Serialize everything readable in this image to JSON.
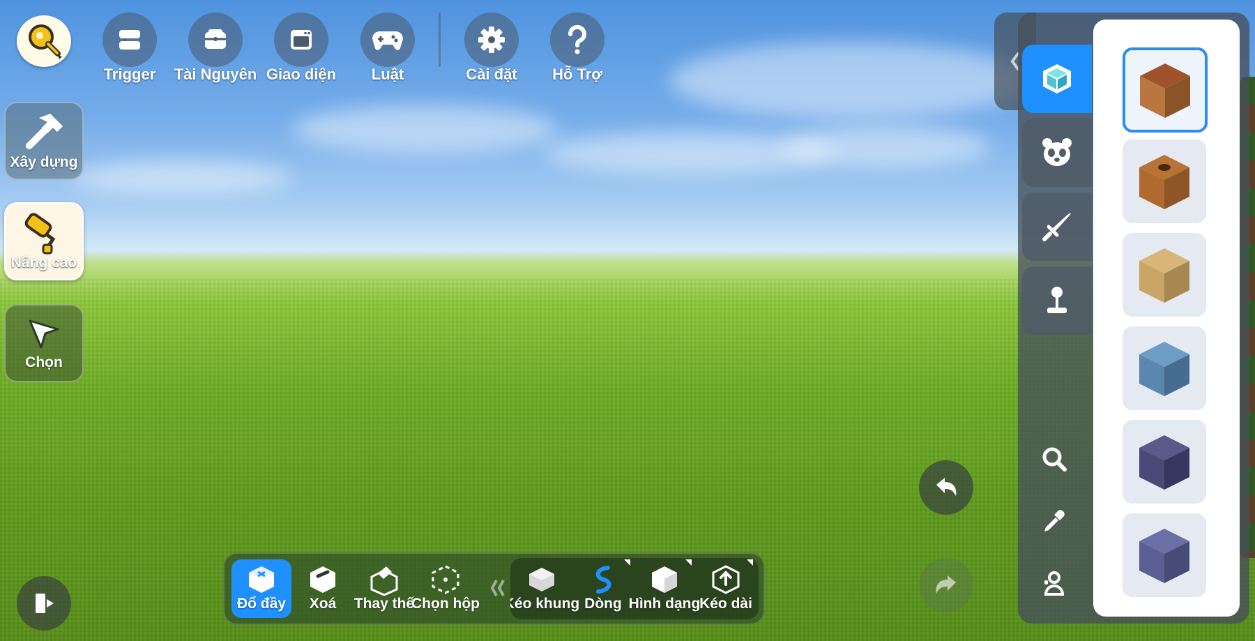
{
  "top_bar": {
    "items": [
      {
        "id": "trigger",
        "label": "Trigger",
        "icon": "trigger-icon"
      },
      {
        "id": "resource",
        "label": "Tài Nguyên",
        "icon": "wallet-icon"
      },
      {
        "id": "interface",
        "label": "Giao diện",
        "icon": "window-icon"
      },
      {
        "id": "rules",
        "label": "Luật",
        "icon": "gamepad-icon"
      },
      {
        "id": "settings",
        "label": "Cài đặt",
        "icon": "gear-icon"
      },
      {
        "id": "help",
        "label": "Hỗ Trợ",
        "icon": "question-icon"
      }
    ],
    "logo_icon": "wrench-bulb-icon"
  },
  "modes": {
    "build": {
      "label": "Xây dựng",
      "icon": "hammer-icon"
    },
    "advanced": {
      "label": "Nâng cao",
      "icon": "paint-roller-icon",
      "active": true
    },
    "select": {
      "label": "Chọn",
      "icon": "cursor-arrow-icon"
    }
  },
  "toolbar": {
    "tools": [
      {
        "label": "Đổ đầy",
        "icon": "fill-block-icon",
        "active": true
      },
      {
        "label": "Xoá",
        "icon": "erase-block-icon"
      },
      {
        "label": "Thay thế",
        "icon": "replace-block-icon"
      },
      {
        "label": "Chọn hộp",
        "icon": "box-select-icon"
      }
    ],
    "group2": [
      {
        "label": "Kéo khung",
        "icon": "frame-drag-icon",
        "has_options": false
      },
      {
        "label": "Dòng",
        "icon": "line-curve-icon",
        "has_options": true
      },
      {
        "label": "Hình dạng",
        "icon": "shape-cube-icon",
        "has_options": true
      },
      {
        "label": "Kéo dài",
        "icon": "extend-icon",
        "has_options": true
      }
    ]
  },
  "actions": {
    "undo_icon": "undo-icon",
    "redo_icon": "redo-icon",
    "exit_icon": "exit-door-icon"
  },
  "right_panel": {
    "collapse_icon": "chevron-left-icon",
    "categories": [
      {
        "id": "blocks",
        "icon": "cube-icon",
        "active": true
      },
      {
        "id": "creatures",
        "icon": "panda-icon"
      },
      {
        "id": "items",
        "icon": "sword-icon"
      },
      {
        "id": "devices",
        "icon": "joystick-icon"
      }
    ],
    "tools": [
      {
        "id": "search",
        "icon": "search-icon"
      },
      {
        "id": "picker",
        "icon": "eyedropper-icon"
      },
      {
        "id": "character",
        "icon": "character-icon"
      }
    ],
    "blocks": [
      {
        "name": "dirt-grass-block",
        "top": "#a0522d",
        "side": "#b9773f",
        "dark": "#8a5428",
        "selected": true
      },
      {
        "name": "hollow-dirt-block",
        "top": "#b87335",
        "side": "#b06a30",
        "dark": "#8e5626"
      },
      {
        "name": "sand-block",
        "top": "#d8b679",
        "side": "#c9a566",
        "dark": "#a98750"
      },
      {
        "name": "blue-stone-block",
        "top": "#6f9cc4",
        "side": "#5b86ae",
        "dark": "#466c92"
      },
      {
        "name": "dark-purple-stone-block",
        "top": "#5a5a8a",
        "side": "#4a4a78",
        "dark": "#363660"
      },
      {
        "name": "slate-blue-block",
        "top": "#6a6fa4",
        "side": "#5b5f93",
        "dark": "#474b78"
      }
    ]
  },
  "colors": {
    "accent": "#1e90ff",
    "panel": "#505c68",
    "logo_yellow": "#f3c21a"
  }
}
